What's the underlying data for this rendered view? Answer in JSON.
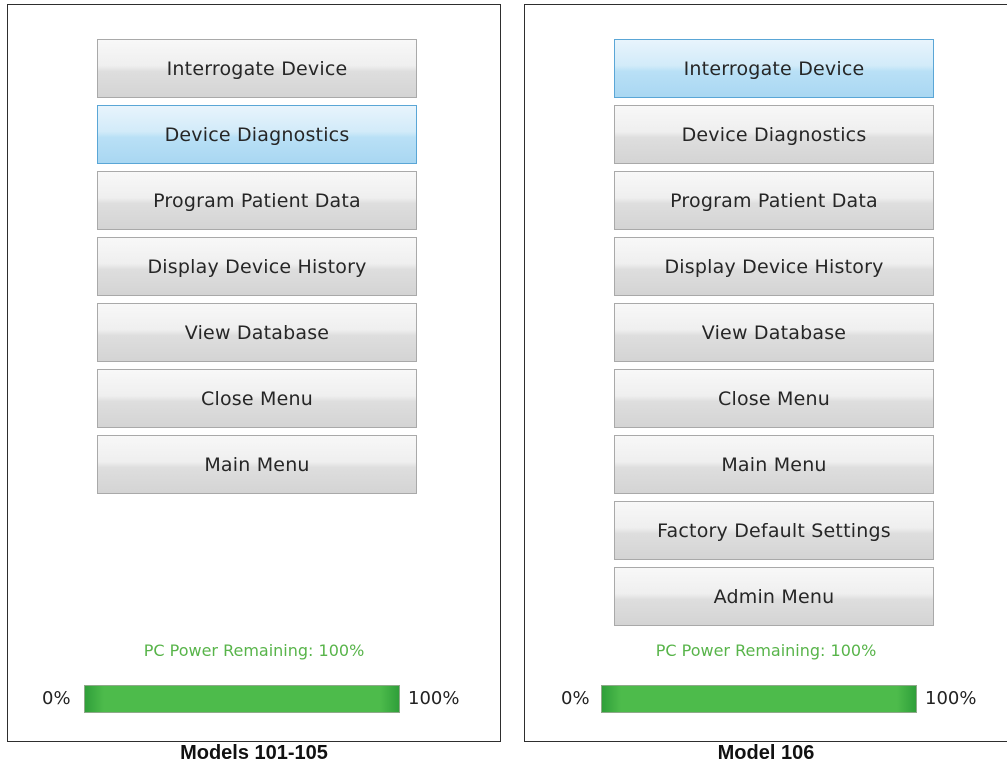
{
  "panels": [
    {
      "menu": [
        {
          "label": "Interrogate Device",
          "highlighted": false
        },
        {
          "label": "Device Diagnostics",
          "highlighted": true
        },
        {
          "label": "Program Patient Data",
          "highlighted": false
        },
        {
          "label": "Display Device History",
          "highlighted": false
        },
        {
          "label": "View Database",
          "highlighted": false
        },
        {
          "label": "Close Menu",
          "highlighted": false
        },
        {
          "label": "Main Menu",
          "highlighted": false
        }
      ],
      "power_label": "PC Power Remaining: 100%",
      "power_fraction": 1.0,
      "min_label": "0%",
      "max_label": "100%",
      "caption": "Models 101-105"
    },
    {
      "menu": [
        {
          "label": "Interrogate Device",
          "highlighted": true
        },
        {
          "label": "Device Diagnostics",
          "highlighted": false
        },
        {
          "label": "Program Patient Data",
          "highlighted": false
        },
        {
          "label": "Display Device History",
          "highlighted": false
        },
        {
          "label": "View Database",
          "highlighted": false
        },
        {
          "label": "Close Menu",
          "highlighted": false
        },
        {
          "label": "Main Menu",
          "highlighted": false
        },
        {
          "label": "Factory Default Settings",
          "highlighted": false
        },
        {
          "label": "Admin Menu",
          "highlighted": false
        }
      ],
      "power_label": "PC Power Remaining: 100%",
      "power_fraction": 1.0,
      "min_label": "0%",
      "max_label": "100%",
      "caption": "Model 106"
    }
  ],
  "colors": {
    "highlight": "#b9e0f6",
    "power_text": "#58b44a",
    "power_bar": "#4dbb4b"
  }
}
